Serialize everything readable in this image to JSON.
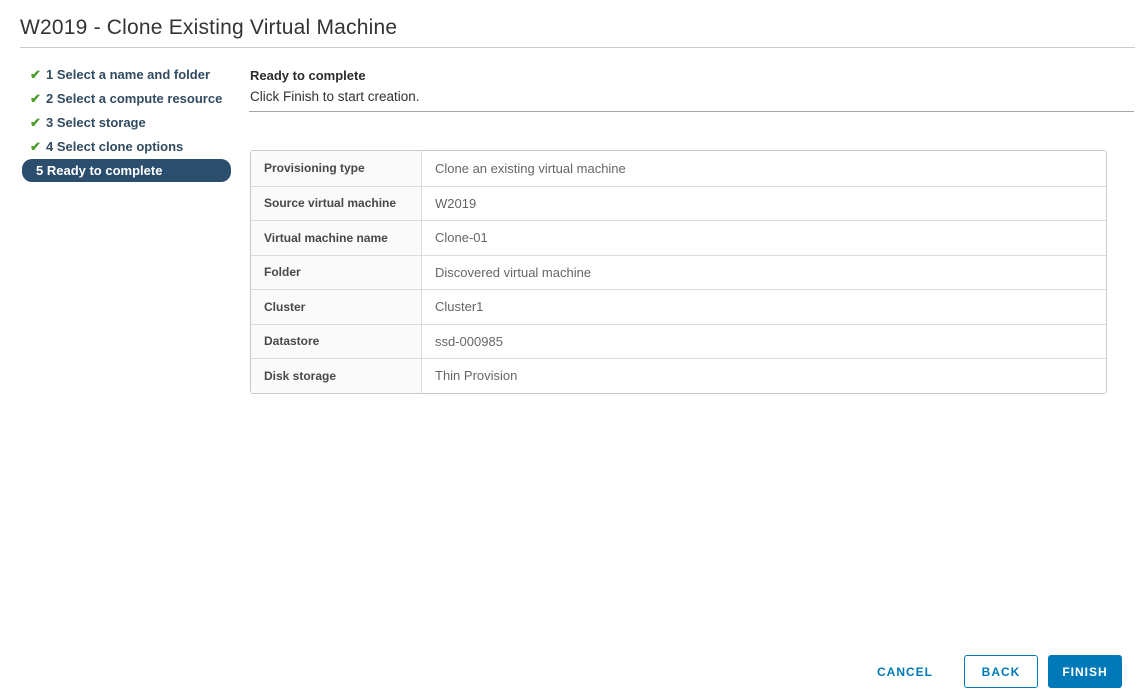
{
  "header": {
    "title": "W2019 - Clone Existing Virtual Machine"
  },
  "steps": {
    "items": [
      {
        "number": "1",
        "label": "Select a name and folder",
        "completed": true,
        "active": false
      },
      {
        "number": "2",
        "label": "Select a compute resource",
        "completed": true,
        "active": false
      },
      {
        "number": "3",
        "label": "Select storage",
        "completed": true,
        "active": false
      },
      {
        "number": "4",
        "label": "Select clone options",
        "completed": true,
        "active": false
      },
      {
        "number": "5",
        "label": "Ready to complete",
        "completed": false,
        "active": true
      }
    ]
  },
  "content": {
    "heading": "Ready to complete",
    "subheading": "Click Finish to start creation."
  },
  "summary_table": {
    "rows": [
      {
        "label": "Provisioning type",
        "value": "Clone an existing virtual machine"
      },
      {
        "label": "Source virtual machine",
        "value": "W2019"
      },
      {
        "label": "Virtual machine name",
        "value": "Clone-01"
      },
      {
        "label": "Folder",
        "value": "Discovered virtual machine"
      },
      {
        "label": "Cluster",
        "value": "Cluster1"
      },
      {
        "label": "Datastore",
        "value": "ssd-000985"
      },
      {
        "label": "Disk storage",
        "value": "Thin Provision"
      }
    ]
  },
  "footer": {
    "cancel_label": "CANCEL",
    "back_label": "BACK",
    "finish_label": "FINISH"
  },
  "icons": {
    "completed_step": "check-icon",
    "check_glyph": "✔"
  },
  "colors": {
    "action_blue": "#0079b8",
    "active_step_bg": "#2b4d6e",
    "check_green": "#4d9e2f"
  }
}
